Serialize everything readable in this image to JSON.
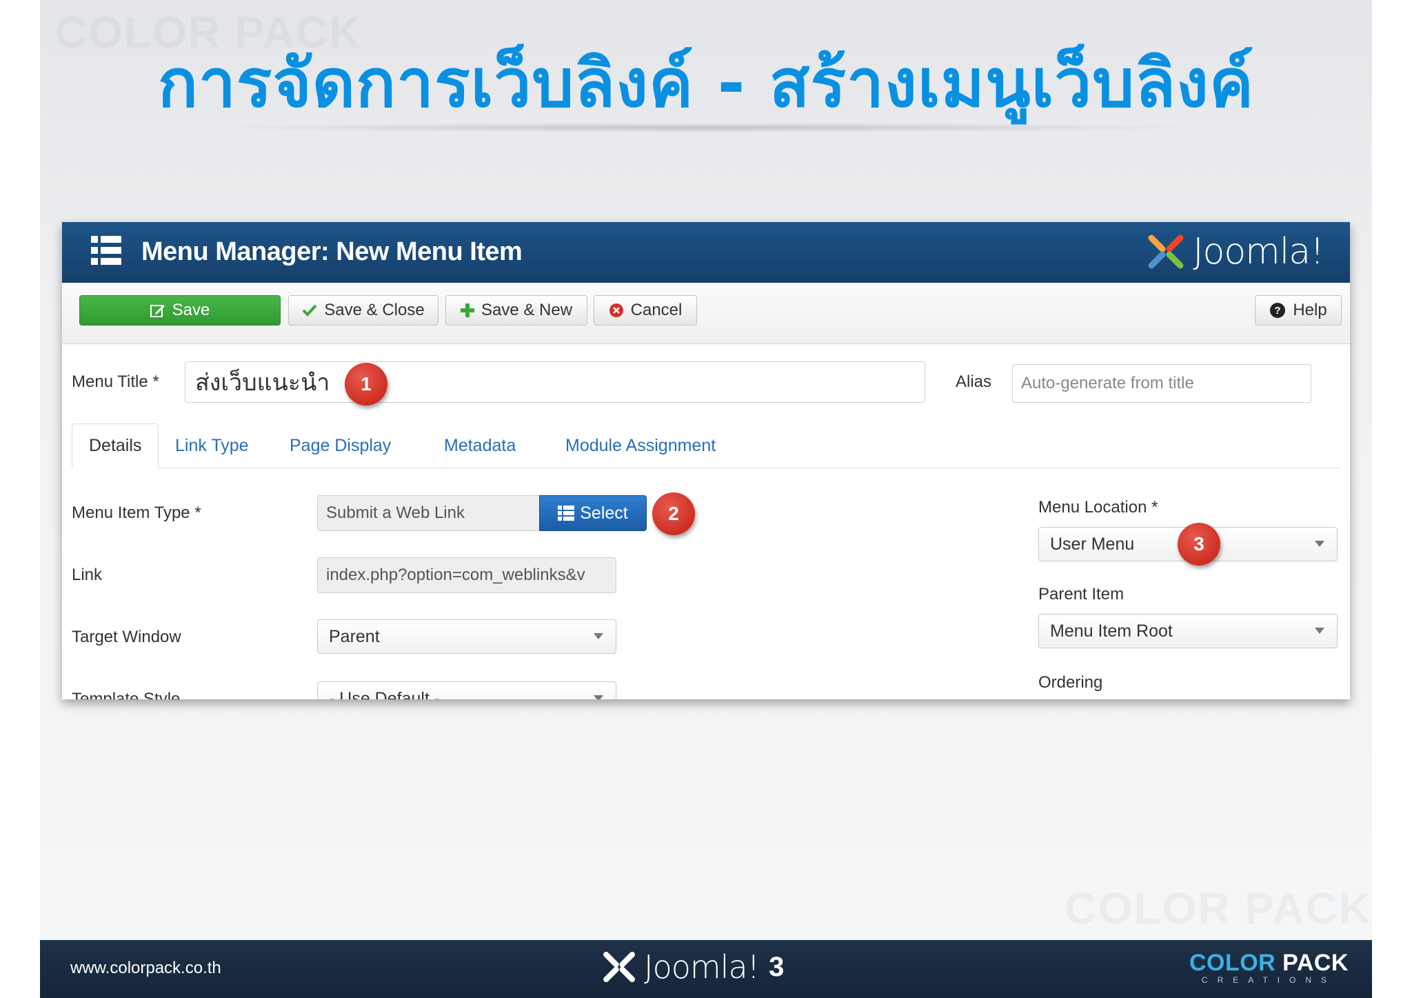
{
  "slide": {
    "title": "การจัดการเว็บลิงค์ - สร้างเมนูเว็บลิงค์",
    "watermark": "COLOR PACK"
  },
  "header": {
    "title": "Menu Manager: New Menu Item",
    "logo_text": "Joomla!"
  },
  "toolbar": {
    "save_label": "Save",
    "save_close_label": "Save & Close",
    "save_new_label": "Save & New",
    "cancel_label": "Cancel",
    "help_label": "Help"
  },
  "form": {
    "menu_title_label": "Menu Title *",
    "menu_title_value": "ส่งเว็บแนะนำ",
    "alias_label": "Alias",
    "alias_placeholder": "Auto-generate from title"
  },
  "tabs": [
    {
      "label": "Details",
      "active": true
    },
    {
      "label": "Link Type",
      "active": false
    },
    {
      "label": "Page Display",
      "active": false
    },
    {
      "label": "Metadata",
      "active": false
    },
    {
      "label": "Module Assignment",
      "active": false
    }
  ],
  "details": {
    "menu_item_type_label": "Menu Item Type *",
    "menu_item_type_value": "Submit a Web Link",
    "select_label": "Select",
    "link_label": "Link",
    "link_value": "index.php?option=com_weblinks&v",
    "target_window_label": "Target Window",
    "target_window_value": "Parent",
    "template_style_label": "Template Style",
    "template_style_value": "- Use Default -",
    "menu_location_label": "Menu Location *",
    "menu_location_value": "User Menu",
    "parent_item_label": "Parent Item",
    "parent_item_value": "Menu Item Root",
    "ordering_label": "Ordering"
  },
  "badges": [
    "1",
    "2",
    "3"
  ],
  "footer": {
    "url": "www.colorpack.co.th",
    "joomla_text": "Joomla!",
    "joomla_version": "3",
    "brand_color": "COLOR",
    "brand_pack": "PACK",
    "brand_sub": "CREATIONS"
  },
  "colors": {
    "title_blue": "#0a90e2",
    "header_navy": "#1a4a7c",
    "save_green": "#3aa83d",
    "select_blue": "#2a6eb5",
    "badge_red": "#d0312d",
    "footer_navy": "#1b2c41"
  }
}
